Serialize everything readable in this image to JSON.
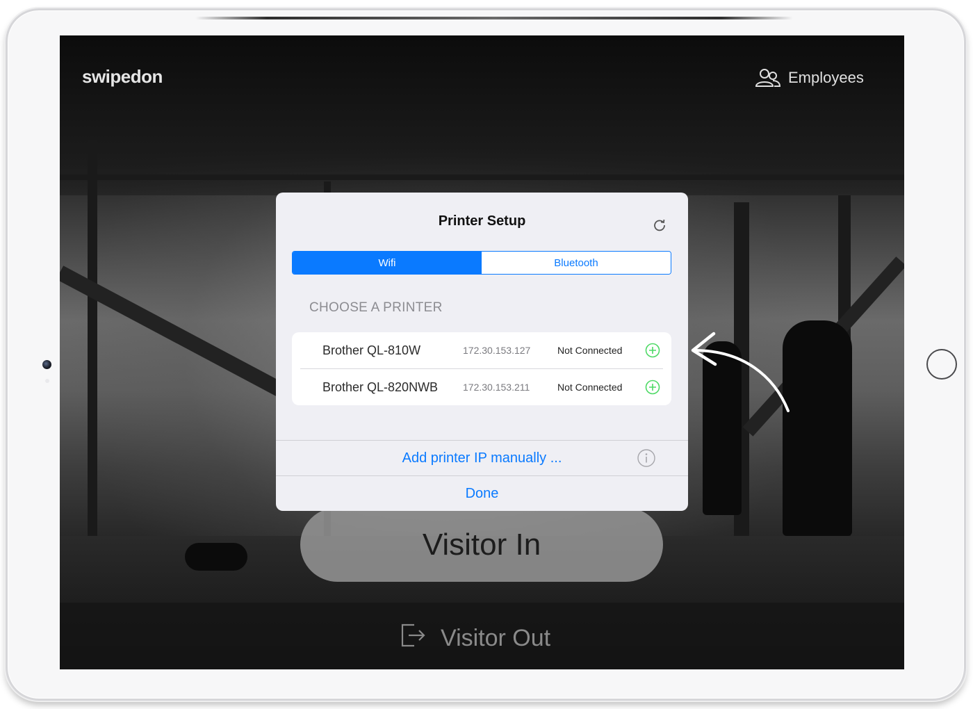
{
  "app": {
    "logo": "swipedon"
  },
  "header": {
    "employees_label": "Employees"
  },
  "main": {
    "visitor_in_label": "Visitor In",
    "visitor_out_label": "Visitor Out"
  },
  "modal": {
    "title": "Printer Setup",
    "tabs": [
      {
        "label": "Wifi",
        "selected": true
      },
      {
        "label": "Bluetooth",
        "selected": false
      }
    ],
    "section_header": "CHOOSE A PRINTER",
    "printers": [
      {
        "name": "Brother QL-810W",
        "ip": "172.30.153.127",
        "status": "Not Connected"
      },
      {
        "name": "Brother QL-820NWB",
        "ip": "172.30.153.211",
        "status": "Not Connected"
      }
    ],
    "add_manual_label": "Add printer IP manually ...",
    "done_label": "Done"
  },
  "colors": {
    "accent": "#0a7aff",
    "add_icon": "#4cd964",
    "modal_bg": "#efeff4"
  },
  "icons": [
    "refresh-icon",
    "plus-circle-icon",
    "info-icon",
    "employees-icon",
    "exit-icon",
    "arrow-annotation"
  ]
}
